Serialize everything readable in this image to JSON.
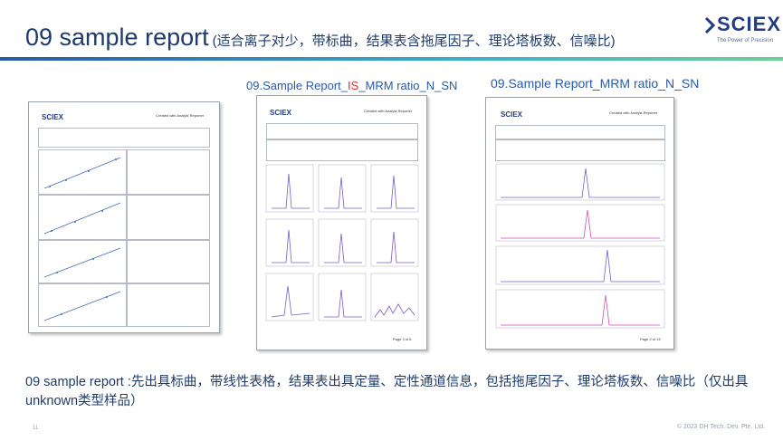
{
  "slide": {
    "title_main": "09 sample report",
    "title_sub": "(适合离子对少，带标曲，结果表含拖尾因子、理论塔板数、信噪比)",
    "logo_word": "SCIEX",
    "logo_tagline": "The Power of Precision",
    "caption_middle_prefix": "09.Sample Report_",
    "caption_middle_highlight": "IS",
    "caption_middle_suffix": "_MRM ratio_N_SN",
    "caption_right": "09.Sample Report_MRM ratio_N_SN",
    "description": "09 sample report :先出具标曲，带线性表格，结果表出具定量、定性通道信息，包括拖尾因子、理论塔板数、信噪比（仅出具unknown类型样品）",
    "page_number": "11",
    "copyright": "© 2023 DH Tech. Dev. Pte. Ltd."
  },
  "documents": {
    "doc1": {
      "logo": "SCIEX",
      "header": "Created with Analyst Reporter"
    },
    "doc2": {
      "logo": "SCIEX",
      "header": "Created with Analyst Reporter",
      "page": "Page 3 of 6"
    },
    "doc3": {
      "logo": "SCIEX",
      "header": "Created with Analyst Reporter",
      "page": "Page 2 of 15"
    }
  },
  "colors": {
    "title": "#1f3b6b",
    "caption": "#2b5aa8",
    "highlight": "#e0312f",
    "brand": "#243b86"
  }
}
